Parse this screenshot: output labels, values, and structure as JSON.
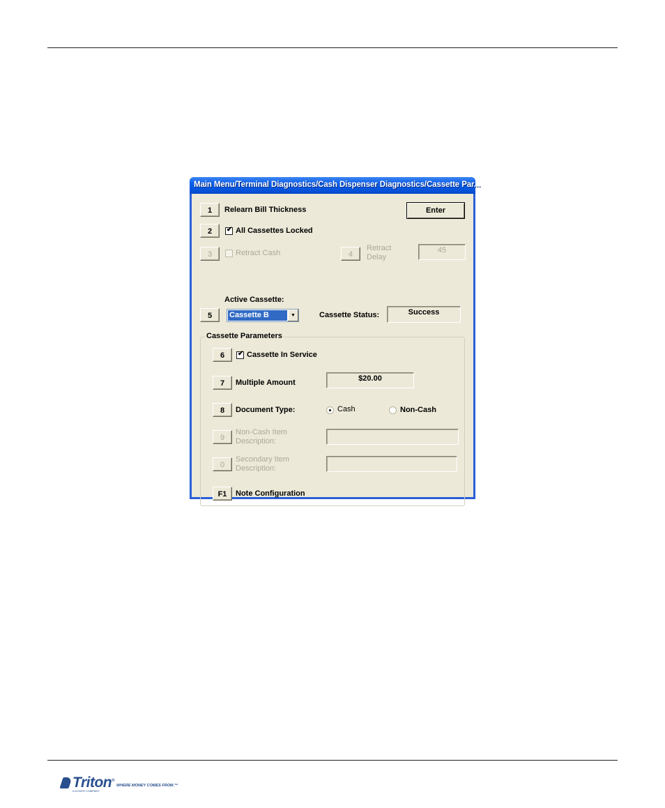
{
  "window": {
    "title": "Main Menu/Terminal Diagnostics/Cash Dispenser Diagnostics/Cassette Par..."
  },
  "enter_button": {
    "label": "Enter"
  },
  "rows": {
    "relearn": {
      "key": "1",
      "label": "Relearn Bill Thickness"
    },
    "all_locked": {
      "key": "2",
      "label": "All Cassettes Locked",
      "checked": true
    },
    "retract_cash": {
      "key": "3",
      "label": "Retract Cash",
      "checked": false,
      "disabled": true
    },
    "retract_delay": {
      "key": "4",
      "label_line1": "Retract",
      "label_line2": "Delay",
      "value": "45",
      "disabled": true
    },
    "active_cassette": {
      "key": "5",
      "label": "Active Cassette:",
      "selected": "Cassette B",
      "arrow": "▼"
    },
    "cassette_status": {
      "label": "Cassette Status:",
      "value": "Success"
    }
  },
  "cassette_parameters": {
    "legend": "Cassette Parameters",
    "in_service": {
      "key": "6",
      "label": "Cassette In Service",
      "checked": true
    },
    "multiple_amount": {
      "key": "7",
      "label": "Multiple Amount",
      "value": "$20.00"
    },
    "document_type": {
      "key": "8",
      "label": "Document Type:",
      "options": [
        "Cash",
        "Non-Cash"
      ],
      "selected": "Cash"
    },
    "non_cash_desc": {
      "key": "9",
      "label_line1": "Non-Cash Item",
      "label_line2": "Description:",
      "value": "",
      "disabled": true
    },
    "secondary_desc": {
      "key": "0",
      "label_line1": "Secondary Item",
      "label_line2": "Description:",
      "value": "",
      "disabled": true
    },
    "note_config": {
      "key": "F1",
      "label": "Note Configuration"
    }
  },
  "footer": {
    "logo_text": "Triton",
    "logo_trademark": "®",
    "tagline": "WHERE MONEY COMES FROM.™",
    "sub": "A DOVER COMPANY"
  },
  "icons": {
    "check": "✓",
    "checkbox_tick": "✔"
  }
}
